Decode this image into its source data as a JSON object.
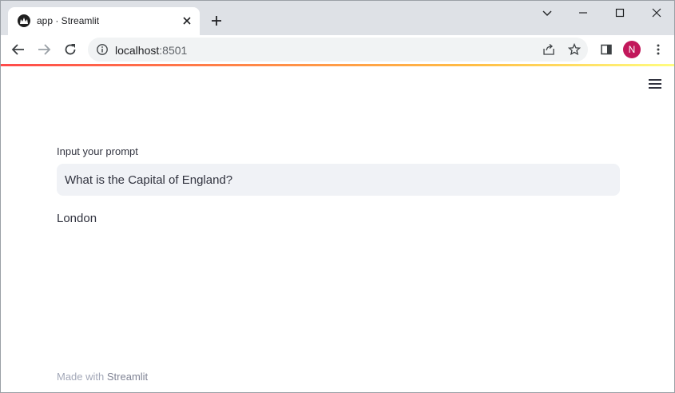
{
  "browser": {
    "tab_title": "app · Streamlit",
    "url_host": "localhost",
    "url_port": ":8501",
    "profile_initial": "N",
    "profile_color": "#c2185b"
  },
  "icons": [
    "streamlit-favicon-icon",
    "close-icon",
    "plus-icon",
    "chevron-down-icon",
    "minimize-icon",
    "maximize-icon",
    "back-arrow-icon",
    "forward-arrow-icon",
    "reload-icon",
    "info-icon",
    "share-icon",
    "star-icon",
    "side-panel-icon",
    "kebab-menu-icon",
    "hamburger-menu-icon"
  ],
  "app": {
    "input_label": "Input your prompt",
    "input_value": "What is the Capital of England?",
    "answer": "London",
    "footer_prefix": "Made with ",
    "footer_brand": "Streamlit"
  },
  "colors": {
    "accent": "#ff4b4b",
    "input_bg": "#f0f2f6",
    "text": "#31333f"
  }
}
